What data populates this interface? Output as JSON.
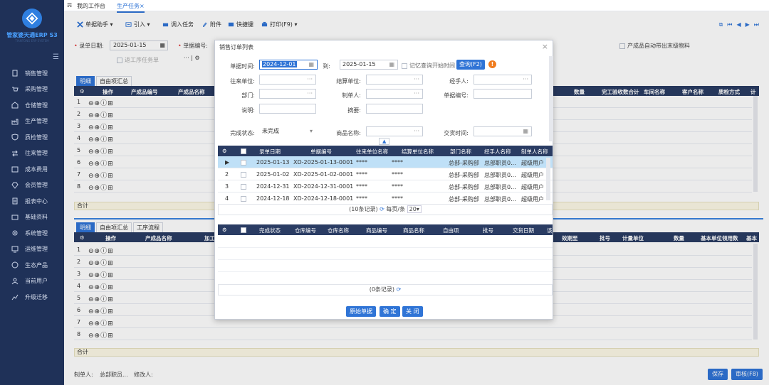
{
  "sidebar": {
    "brand": "管家婆天通ERP S3",
    "brand_sub": "TIANTONG ERP SYSTEM",
    "items": [
      {
        "label": "销售管理",
        "icon": "clipboard-icon"
      },
      {
        "label": "采购管理",
        "icon": "cart-icon"
      },
      {
        "label": "仓储管理",
        "icon": "warehouse-icon"
      },
      {
        "label": "生产管理",
        "icon": "factory-icon"
      },
      {
        "label": "质检管理",
        "icon": "shield-check-icon"
      },
      {
        "label": "往来管理",
        "icon": "transfer-icon"
      },
      {
        "label": "成本费用",
        "icon": "cost-icon"
      },
      {
        "label": "会员管理",
        "icon": "diamond-icon"
      },
      {
        "label": "报表中心",
        "icon": "report-icon"
      },
      {
        "label": "基础资料",
        "icon": "database-icon"
      },
      {
        "label": "系统管理",
        "icon": "gear-icon"
      },
      {
        "label": "运维管理",
        "icon": "monitor-icon"
      },
      {
        "label": "生态产品",
        "icon": "ecology-icon"
      },
      {
        "label": "当前用户",
        "icon": "user-icon"
      },
      {
        "label": "升级迁移",
        "icon": "chart-up-icon"
      }
    ]
  },
  "tabs": [
    {
      "label": "我的工作台"
    },
    {
      "label": "生产任务"
    }
  ],
  "toolbar": {
    "assistant": "单据助手",
    "import": "引入",
    "transfer_task": "调入任务",
    "attachment": "附件",
    "shortcut": "快捷键",
    "print": "打印(F9)"
  },
  "form": {
    "entry_date_label": "录单日期:",
    "entry_date": "2025-01-15",
    "doc_no_label": "单据编号:",
    "material_option": "产成品自动带出末级物料",
    "work_order": "返工序任务单"
  },
  "upper_tabs": [
    "明细",
    "自由项汇总"
  ],
  "upper_columns": [
    "操作",
    "产成品编号",
    "产成品名称",
    "数量",
    "完工验收数合计",
    "车间名称",
    "客户名称",
    "质检方式",
    "计"
  ],
  "row_numbers": [
    "1",
    "2",
    "3",
    "4",
    "5",
    "6",
    "7",
    "8"
  ],
  "sum_label": "合计",
  "lower_tabs": [
    "明细",
    "自由项汇总",
    "工序流程"
  ],
  "lower_columns": [
    "操作",
    "产成品名称",
    "加工",
    "效期至",
    "批号",
    "计量单位",
    "数量",
    "基本单位领用数",
    "基本"
  ],
  "footer": {
    "maker_label": "制单人:",
    "maker": "总部职员...",
    "modifier_label": "修改人:",
    "save": "保存",
    "audit": "审核(F8)"
  },
  "modal": {
    "title": "销售订单列表",
    "date_label": "单据时间:",
    "date_from": "2024-12-01",
    "to_label": "到:",
    "date_to": "2025-01-15",
    "remember_label": "记忆查询开始时间",
    "query_btn": "查询(F2)",
    "warn_mark": "!",
    "partner_label": "往来单位:",
    "settle_label": "结算单位:",
    "handler_label": "经手人:",
    "dept_label": "部门:",
    "maker_label": "制单人:",
    "docno_label": "单据编号:",
    "note_label": "说明:",
    "summary_label": "摘要:",
    "status_label": "完成状态:",
    "status_value": "未完成",
    "product_label": "商品名称:",
    "delivery_label": "交货时间:",
    "columns": [
      "录单日期",
      "单据编号",
      "往来单位名称",
      "结算单位名称",
      "部门名称",
      "经手人名称",
      "制单人名称"
    ],
    "rows": [
      {
        "n": "▶",
        "date": "2025-01-13",
        "no": "XD-2025-01-13-0001",
        "partner": "****",
        "settle": "****",
        "dept": "总部-采购部",
        "handler": "总部职员0...",
        "maker": "超级用户"
      },
      {
        "n": "2",
        "date": "2025-01-02",
        "no": "XD-2025-01-02-0001",
        "partner": "****",
        "settle": "****",
        "dept": "总部-采购部",
        "handler": "总部职员0...",
        "maker": "超级用户"
      },
      {
        "n": "3",
        "date": "2024-12-31",
        "no": "XD-2024-12-31-0001",
        "partner": "****",
        "settle": "****",
        "dept": "总部-采购部",
        "handler": "总部职员0...",
        "maker": "超级用户"
      },
      {
        "n": "4",
        "date": "2024-12-18",
        "no": "XD-2024-12-18-0001",
        "partner": "****",
        "settle": "****",
        "dept": "总部-采购部",
        "handler": "总部职员0...",
        "maker": "超级用户"
      }
    ],
    "pager_text": "(10条记录)",
    "per_page_label": "每页/条",
    "per_page": "20",
    "detail_columns": [
      "完成状态",
      "仓库编号",
      "仓库名称",
      "商品编号",
      "商品名称",
      "自由项",
      "批号",
      "交货日期",
      "该"
    ],
    "detail_pager": "(0条记录)",
    "btn_original": "原始单据",
    "btn_ok": "确 定",
    "btn_close": "关 闭"
  }
}
